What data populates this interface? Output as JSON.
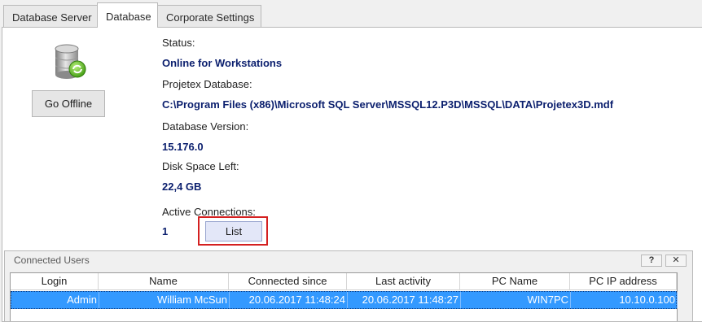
{
  "tabs": [
    {
      "label": "Database Server"
    },
    {
      "label": "Database"
    },
    {
      "label": "Corporate Settings"
    }
  ],
  "database": {
    "go_offline_label": "Go Offline",
    "status_label": "Status:",
    "status_value": "Online for Workstations",
    "db_label": "Projetex Database:",
    "db_value": "C:\\Program Files (x86)\\Microsoft SQL Server\\MSSQL12.P3D\\MSSQL\\DATA\\Projetex3D.mdf",
    "version_label": "Database Version:",
    "version_value": "15.176.0",
    "disk_label": "Disk Space Left:",
    "disk_value": "22,4 GB",
    "connections_label": "Active Connections:",
    "connections_value": "1",
    "list_button_label": "List",
    "icon": "database-online-icon"
  },
  "connected_users": {
    "title": "Connected Users",
    "help_label": "?",
    "close_label": "✕",
    "columns": [
      "Login",
      "Name",
      "Connected since",
      "Last activity",
      "PC Name",
      "PC IP address"
    ],
    "rows": [
      {
        "login": "Admin",
        "name": "William McSun",
        "connected_since": "20.06.2017 11:48:24",
        "last_activity": "20.06.2017 11:48:27",
        "pc_name": "WIN7PC",
        "pc_ip": "10.10.0.100"
      }
    ]
  },
  "colors": {
    "accent_value_text": "#0b1f6e",
    "selection": "#3399ff",
    "highlight_border": "#d42020"
  }
}
